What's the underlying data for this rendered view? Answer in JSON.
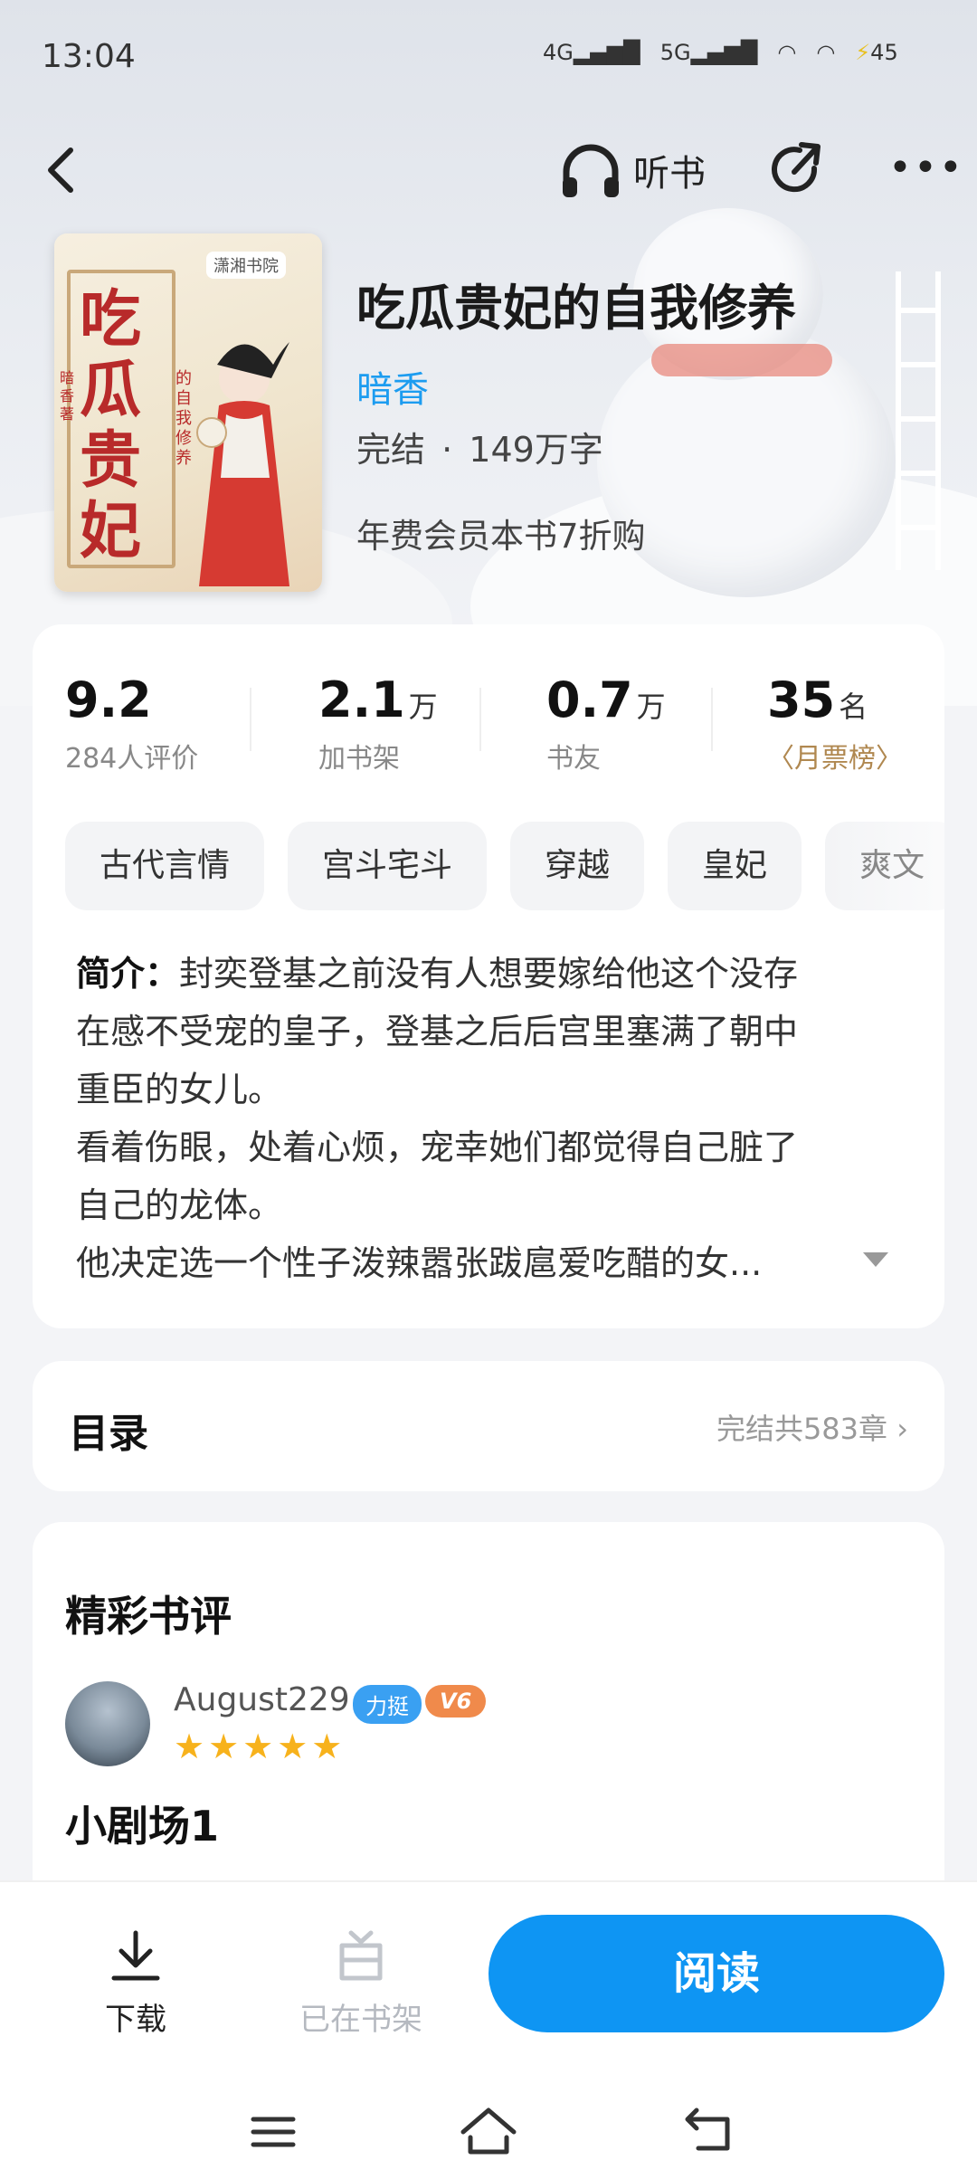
{
  "status_bar": {
    "time": "13:04",
    "signal1": "4G",
    "signal2": "5G",
    "battery": "45"
  },
  "header": {
    "listen_label": "听书"
  },
  "book": {
    "cover": {
      "title": "吃瓜贵妃",
      "subtitle": "的自我修养",
      "publisher": "潇湘书院",
      "author_mark": "暗香 著"
    },
    "title": "吃瓜贵妃的自我修养",
    "author": "暗香",
    "status": "完结",
    "dot": "·",
    "words": "149万字",
    "promo": "年费会员本书7折购"
  },
  "stats": [
    {
      "value": "9.2",
      "unit": "",
      "label": "284人评价"
    },
    {
      "value": "2.1",
      "unit": "万",
      "label": "加书架"
    },
    {
      "value": "0.7",
      "unit": "万",
      "label": "书友"
    },
    {
      "value": "35",
      "unit": "名",
      "label": "月票榜"
    }
  ],
  "tags": [
    "古代言情",
    "宫斗宅斗",
    "穿越",
    "皇妃",
    "爽文"
  ],
  "intro": {
    "label": "简介：",
    "lines": [
      "封奕登基之前没有人想要嫁给他这个没存",
      "在感不受宠的皇子，登基之后后宫里塞满了朝中",
      "重臣的女儿。",
      "看着伤眼，处着心烦，宠幸她们都觉得自己脏了",
      "自己的龙体。",
      "他决定选一个性子泼辣嚣张跋扈爱吃醋的女..."
    ]
  },
  "toc": {
    "title": "目录",
    "summary": "完结共583章 ›"
  },
  "reviews": {
    "heading": "精彩书评",
    "items": [
      {
        "username": "August229",
        "badge_support": "力挺",
        "badge_level": "V6",
        "stars": "★★★★★",
        "title": "小剧场1"
      }
    ]
  },
  "bottom_bar": {
    "download": "下载",
    "on_shelf": "已在书架",
    "read": "阅读"
  },
  "colors": {
    "accent": "#0e95f3",
    "author_link": "#1c9cf0",
    "star": "#f7b21c",
    "rank": "#b08850"
  }
}
